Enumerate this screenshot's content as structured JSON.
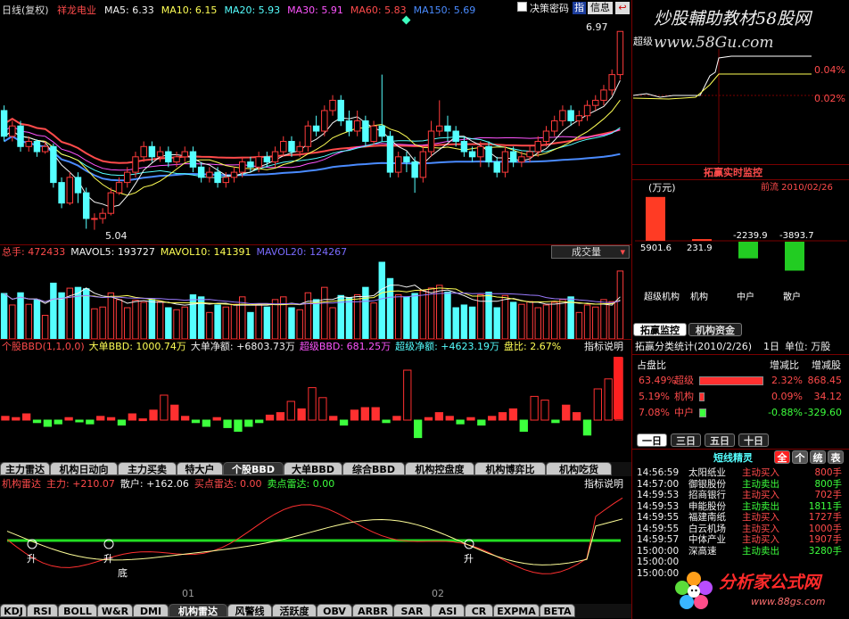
{
  "header": {
    "period": "日线(复权)",
    "stock": "祥龙电业",
    "ma": [
      {
        "label": "MA5: 6.33",
        "color": "#f2f2f2"
      },
      {
        "label": "MA10: 6.15",
        "color": "#ffff55"
      },
      {
        "label": "MA20: 5.93",
        "color": "#55ffff"
      },
      {
        "label": "MA30: 5.91",
        "color": "#ff55ff"
      },
      {
        "label": "MA60: 5.83",
        "color": "#ff4b4b"
      },
      {
        "label": "MA150: 5.69",
        "color": "#4a8bff"
      }
    ],
    "checkbox_label": "决策密码",
    "icons": [
      "指",
      "信息"
    ],
    "watermark": "炒股輔助教材58股网",
    "watermark_url": "www.58Gu.com"
  },
  "main_chart": {
    "price_high": "6.97",
    "price_low": "5.04",
    "price_low_label": "5.04",
    "candles": [
      [
        6.2,
        5.95,
        6.25,
        5.9
      ],
      [
        5.95,
        6.05,
        6.1,
        5.9
      ],
      [
        6.05,
        5.85,
        6.1,
        5.8
      ],
      [
        5.85,
        5.9,
        5.95,
        5.8
      ],
      [
        5.9,
        5.8,
        5.92,
        5.75
      ],
      [
        5.8,
        5.85,
        5.9,
        5.78
      ],
      [
        5.85,
        5.5,
        5.88,
        5.45
      ],
      [
        5.5,
        5.3,
        5.55,
        5.25
      ],
      [
        5.3,
        5.55,
        5.6,
        5.28
      ],
      [
        5.55,
        5.4,
        5.6,
        5.3
      ],
      [
        5.4,
        5.15,
        5.45,
        5.05
      ],
      [
        5.15,
        5.15,
        5.2,
        5.04
      ],
      [
        5.15,
        5.2,
        5.25,
        5.1
      ],
      [
        5.2,
        5.4,
        5.45,
        5.18
      ],
      [
        5.4,
        5.5,
        5.55,
        5.38
      ],
      [
        5.5,
        5.6,
        5.65,
        5.45
      ],
      [
        5.6,
        5.75,
        5.8,
        5.55
      ],
      [
        5.75,
        5.85,
        5.9,
        5.7
      ],
      [
        5.85,
        5.75,
        5.9,
        5.7
      ],
      [
        5.75,
        5.8,
        5.85,
        5.7
      ],
      [
        5.8,
        5.7,
        5.85,
        5.65
      ],
      [
        5.7,
        5.75,
        5.8,
        5.65
      ],
      [
        5.75,
        5.8,
        5.85,
        5.7
      ],
      [
        5.8,
        5.65,
        5.85,
        5.6
      ],
      [
        5.65,
        5.55,
        5.7,
        5.5
      ],
      [
        5.55,
        5.6,
        5.65,
        5.5
      ],
      [
        5.6,
        5.5,
        5.65,
        5.45
      ],
      [
        5.5,
        5.55,
        5.6,
        5.45
      ],
      [
        5.55,
        5.6,
        5.65,
        5.5
      ],
      [
        5.6,
        5.7,
        5.75,
        5.55
      ],
      [
        5.7,
        5.65,
        5.75,
        5.6
      ],
      [
        5.65,
        5.75,
        5.8,
        5.6
      ],
      [
        5.75,
        5.7,
        5.8,
        5.65
      ],
      [
        5.7,
        5.8,
        5.85,
        5.65
      ],
      [
        5.8,
        5.9,
        5.95,
        5.75
      ],
      [
        5.9,
        5.8,
        5.95,
        5.75
      ],
      [
        5.8,
        5.85,
        5.9,
        5.75
      ],
      [
        5.85,
        6.05,
        6.1,
        5.8
      ],
      [
        6.05,
        6.0,
        6.15,
        5.95
      ],
      [
        6.0,
        6.2,
        6.25,
        5.95
      ],
      [
        6.2,
        6.3,
        6.35,
        6.15
      ],
      [
        6.3,
        6.1,
        6.35,
        6.05
      ],
      [
        6.1,
        6.0,
        6.2,
        5.95
      ],
      [
        6.0,
        6.1,
        6.2,
        5.95
      ],
      [
        6.1,
        5.9,
        6.15,
        5.85
      ],
      [
        5.9,
        6.05,
        6.1,
        5.85
      ],
      [
        6.05,
        5.95,
        6.55,
        5.9
      ],
      [
        5.95,
        5.6,
        6.0,
        5.55
      ],
      [
        5.6,
        5.75,
        5.8,
        5.55
      ],
      [
        5.75,
        5.7,
        5.8,
        5.6
      ],
      [
        5.7,
        5.55,
        5.75,
        5.4
      ],
      [
        5.55,
        5.8,
        5.85,
        5.5
      ],
      [
        5.8,
        6.0,
        6.1,
        5.75
      ],
      [
        6.0,
        6.05,
        6.3,
        5.95
      ],
      [
        6.05,
        6.0,
        6.15,
        5.9
      ],
      [
        6.0,
        5.9,
        6.05,
        5.85
      ],
      [
        5.9,
        5.8,
        5.95,
        5.75
      ],
      [
        5.8,
        5.75,
        5.85,
        5.7
      ],
      [
        5.75,
        5.85,
        5.9,
        5.65
      ],
      [
        5.85,
        5.7,
        5.9,
        5.65
      ],
      [
        5.7,
        5.6,
        5.75,
        5.55
      ],
      [
        5.6,
        5.8,
        5.85,
        5.55
      ],
      [
        5.8,
        5.7,
        5.85,
        5.65
      ],
      [
        5.7,
        5.75,
        5.8,
        5.65
      ],
      [
        5.75,
        5.8,
        5.85,
        5.7
      ],
      [
        5.8,
        5.9,
        5.95,
        5.75
      ],
      [
        5.9,
        6.0,
        6.05,
        5.85
      ],
      [
        6.0,
        6.1,
        6.15,
        5.95
      ],
      [
        6.1,
        6.2,
        6.25,
        6.05
      ],
      [
        6.2,
        6.1,
        6.25,
        6.05
      ],
      [
        6.1,
        6.15,
        6.2,
        6.05
      ],
      [
        6.15,
        6.25,
        6.3,
        6.1
      ],
      [
        6.25,
        6.3,
        6.35,
        6.2
      ],
      [
        6.3,
        6.4,
        6.45,
        6.25
      ],
      [
        6.4,
        6.55,
        6.6,
        6.35
      ],
      [
        6.55,
        6.97,
        6.97,
        6.5
      ]
    ],
    "ma_lines": {
      "ma5_color": "#f2f2f2",
      "ma10_color": "#ffff55",
      "ma20_color": "#55ffff",
      "ma30_color": "#ff55ff",
      "ma60_color": "#ff4b4b",
      "ma150_color": "#4a8bff"
    }
  },
  "volume_chart": {
    "labels": [
      {
        "text": "总手: 472433",
        "color": "#ff4b4b"
      },
      {
        "text": "MAVOL5: 193727",
        "color": "#f2f2f2"
      },
      {
        "text": "MAVOL10: 141391",
        "color": "#ffff55"
      },
      {
        "text": "MAVOL20: 124267",
        "color": "#7a6bff"
      }
    ],
    "dropdown": "成交量"
  },
  "bbd_chart": {
    "labels": [
      {
        "text": "个股BBD(1,1,0,0)",
        "color": "#ff4b4b"
      },
      {
        "text": "大单BBD: 1000.74万",
        "color": "#ffff55"
      },
      {
        "text": "大单净额: +6803.73万",
        "color": "#f2f2f2"
      },
      {
        "text": "超级BBD: 681.25万",
        "color": "#ff55ff"
      },
      {
        "text": "超级净额: +4623.19万",
        "color": "#55ffff"
      },
      {
        "text": "盘比: 2.67%",
        "color": "#ffff55"
      }
    ],
    "help": "指标说明",
    "values": [
      0.3,
      0.2,
      0.5,
      -0.2,
      -0.5,
      -0.3,
      0.2,
      -0.1,
      -0.3,
      0.3,
      0.2,
      -0.4,
      0.5,
      0.1,
      0.8,
      2.0,
      1.2,
      0.3,
      -0.2,
      -0.5,
      0.2,
      -0.6,
      -0.9,
      -0.5,
      -0.2,
      0.4,
      0.6,
      1.5,
      0.9,
      2.6,
      1.8,
      0.3,
      -0.4,
      0.8,
      1.0,
      1.0,
      -0.2,
      0.3,
      4.0,
      -1.4,
      0.2,
      0.6,
      0.3,
      -0.3,
      0.2,
      -0.4,
      0.3,
      0.6,
      0.9,
      -0.9,
      1.9,
      1.6,
      -0.2,
      1.2,
      0.6,
      -1.2,
      2.5,
      3.3,
      5.0
    ]
  },
  "mid_tabs": [
    {
      "label": "主力雷达",
      "active": false
    },
    {
      "label": "机构日动向",
      "active": false
    },
    {
      "label": "主力买卖",
      "active": false
    },
    {
      "label": "特大户",
      "active": false
    },
    {
      "label": "个股BBD",
      "active": true
    },
    {
      "label": "大单BBD",
      "active": false
    },
    {
      "label": "综合BBD",
      "active": false
    },
    {
      "label": "机构控盘度",
      "active": false
    },
    {
      "label": "机构博弈比",
      "active": false
    },
    {
      "label": "机构吃货",
      "active": false
    }
  ],
  "radar_chart": {
    "labels": [
      {
        "text": "机构雷达",
        "color": "#ff4b4b"
      },
      {
        "text": "主力: +210.07",
        "color": "#ff4b4b"
      },
      {
        "text": "散户: +162.06",
        "color": "#f2f2f2"
      },
      {
        "text": "买点雷达: 0.00",
        "color": "#ff4b4b"
      },
      {
        "text": "卖点雷达: 0.00",
        "color": "#3dff3d"
      }
    ],
    "help": "指标说明",
    "markers": [
      "升",
      "升",
      "底",
      "升"
    ],
    "month_labels": [
      "01",
      "02"
    ]
  },
  "bottom_tabs": [
    {
      "label": "KDJ",
      "active": false
    },
    {
      "label": "RSI",
      "active": false
    },
    {
      "label": "BOLL",
      "active": false
    },
    {
      "label": "W&R",
      "active": false
    },
    {
      "label": "DMI",
      "active": false
    },
    {
      "label": "机构雷达",
      "active": true
    },
    {
      "label": "风警线",
      "active": false
    },
    {
      "label": "活跃度",
      "active": false
    },
    {
      "label": "OBV",
      "active": false
    },
    {
      "label": "ARBR",
      "active": false
    },
    {
      "label": "SAR",
      "active": false
    },
    {
      "label": "ASI",
      "active": false
    },
    {
      "label": "CR",
      "active": false
    },
    {
      "label": "EXPMA",
      "active": false
    },
    {
      "label": "BETA",
      "active": false
    }
  ],
  "right": {
    "mini_chart": {
      "label_left": "超级",
      "pct_top": "0.04%",
      "pct_bottom": "0.02%"
    },
    "realtime_title": "拓赢实时监控",
    "unit": "(万元)",
    "date": "前流  2010/02/26",
    "bars": [
      {
        "cat": "超级机构",
        "value": 5901.6,
        "label": "5901.6"
      },
      {
        "cat": "机构",
        "value": 231.9,
        "label": "231.9"
      },
      {
        "cat": "中户",
        "value": -2239.9,
        "label": "-2239.9"
      },
      {
        "cat": "散户",
        "value": -3893.7,
        "label": "-3893.7"
      }
    ],
    "mid_tabs": [
      {
        "label": "拓赢监控",
        "active": true
      },
      {
        "label": "机构资金",
        "active": false
      }
    ],
    "stats_header": {
      "title": "拓赢分类统计(2010/2/26)",
      "period": "1日",
      "unit": "单位: 万股"
    },
    "stats_cols": {
      "c1": "占盘比",
      "c2": "增减比",
      "c3": "增减股"
    },
    "stats": [
      {
        "pct": "63.49%",
        "name": "超级",
        "bar": 0.95,
        "color": "#ff3030",
        "ratio": "2.32%",
        "change": "868.45",
        "ratio_color": "#ff4b4b"
      },
      {
        "pct": "5.19%",
        "name": "机构",
        "bar": 0.08,
        "color": "#ff3030",
        "ratio": "0.09%",
        "change": "34.12",
        "ratio_color": "#ff4b4b"
      },
      {
        "pct": "7.08%",
        "name": "中户",
        "bar": 0.1,
        "color": "#3dff3d",
        "ratio": "-0.88%",
        "change": "-329.60",
        "ratio_color": "#3dff3d"
      }
    ],
    "period_tabs": [
      {
        "label": "一日",
        "active": true
      },
      {
        "label": "三日",
        "active": false
      },
      {
        "label": "五日",
        "active": false
      },
      {
        "label": "十日",
        "active": false
      }
    ],
    "elf_title": "短线精灵",
    "elf_buttons": [
      "全",
      "个",
      "统",
      "表"
    ],
    "trades": [
      {
        "time": "14:56:59",
        "name": "太阳纸业",
        "action": "主动买入",
        "vol": "800手",
        "buy": true
      },
      {
        "time": "14:57:00",
        "name": "御银股份",
        "action": "主动卖出",
        "vol": "800手",
        "buy": false
      },
      {
        "time": "14:59:53",
        "name": "招商银行",
        "action": "主动买入",
        "vol": "702手",
        "buy": true
      },
      {
        "time": "14:59:53",
        "name": "申能股份",
        "action": "主动卖出",
        "vol": "1811手",
        "buy": false
      },
      {
        "time": "14:59:55",
        "name": "福建南纸",
        "action": "主动买入",
        "vol": "1727手",
        "buy": true
      },
      {
        "time": "14:59:55",
        "name": "白云机场",
        "action": "主动买入",
        "vol": "1000手",
        "buy": true
      },
      {
        "time": "14:59:57",
        "name": "中体产业",
        "action": "主动买入",
        "vol": "1907手",
        "buy": true
      },
      {
        "time": "15:00:00",
        "name": "深高速",
        "action": "主动卖出",
        "vol": "3280手",
        "buy": false
      },
      {
        "time": "15:00:00",
        "name": "",
        "action": "",
        "vol": "",
        "buy": true
      },
      {
        "time": "15:00:00",
        "name": "",
        "action": "",
        "vol": "",
        "buy": true
      }
    ],
    "logo": "分析家公式网",
    "logo_url": "www.88gs.com"
  }
}
